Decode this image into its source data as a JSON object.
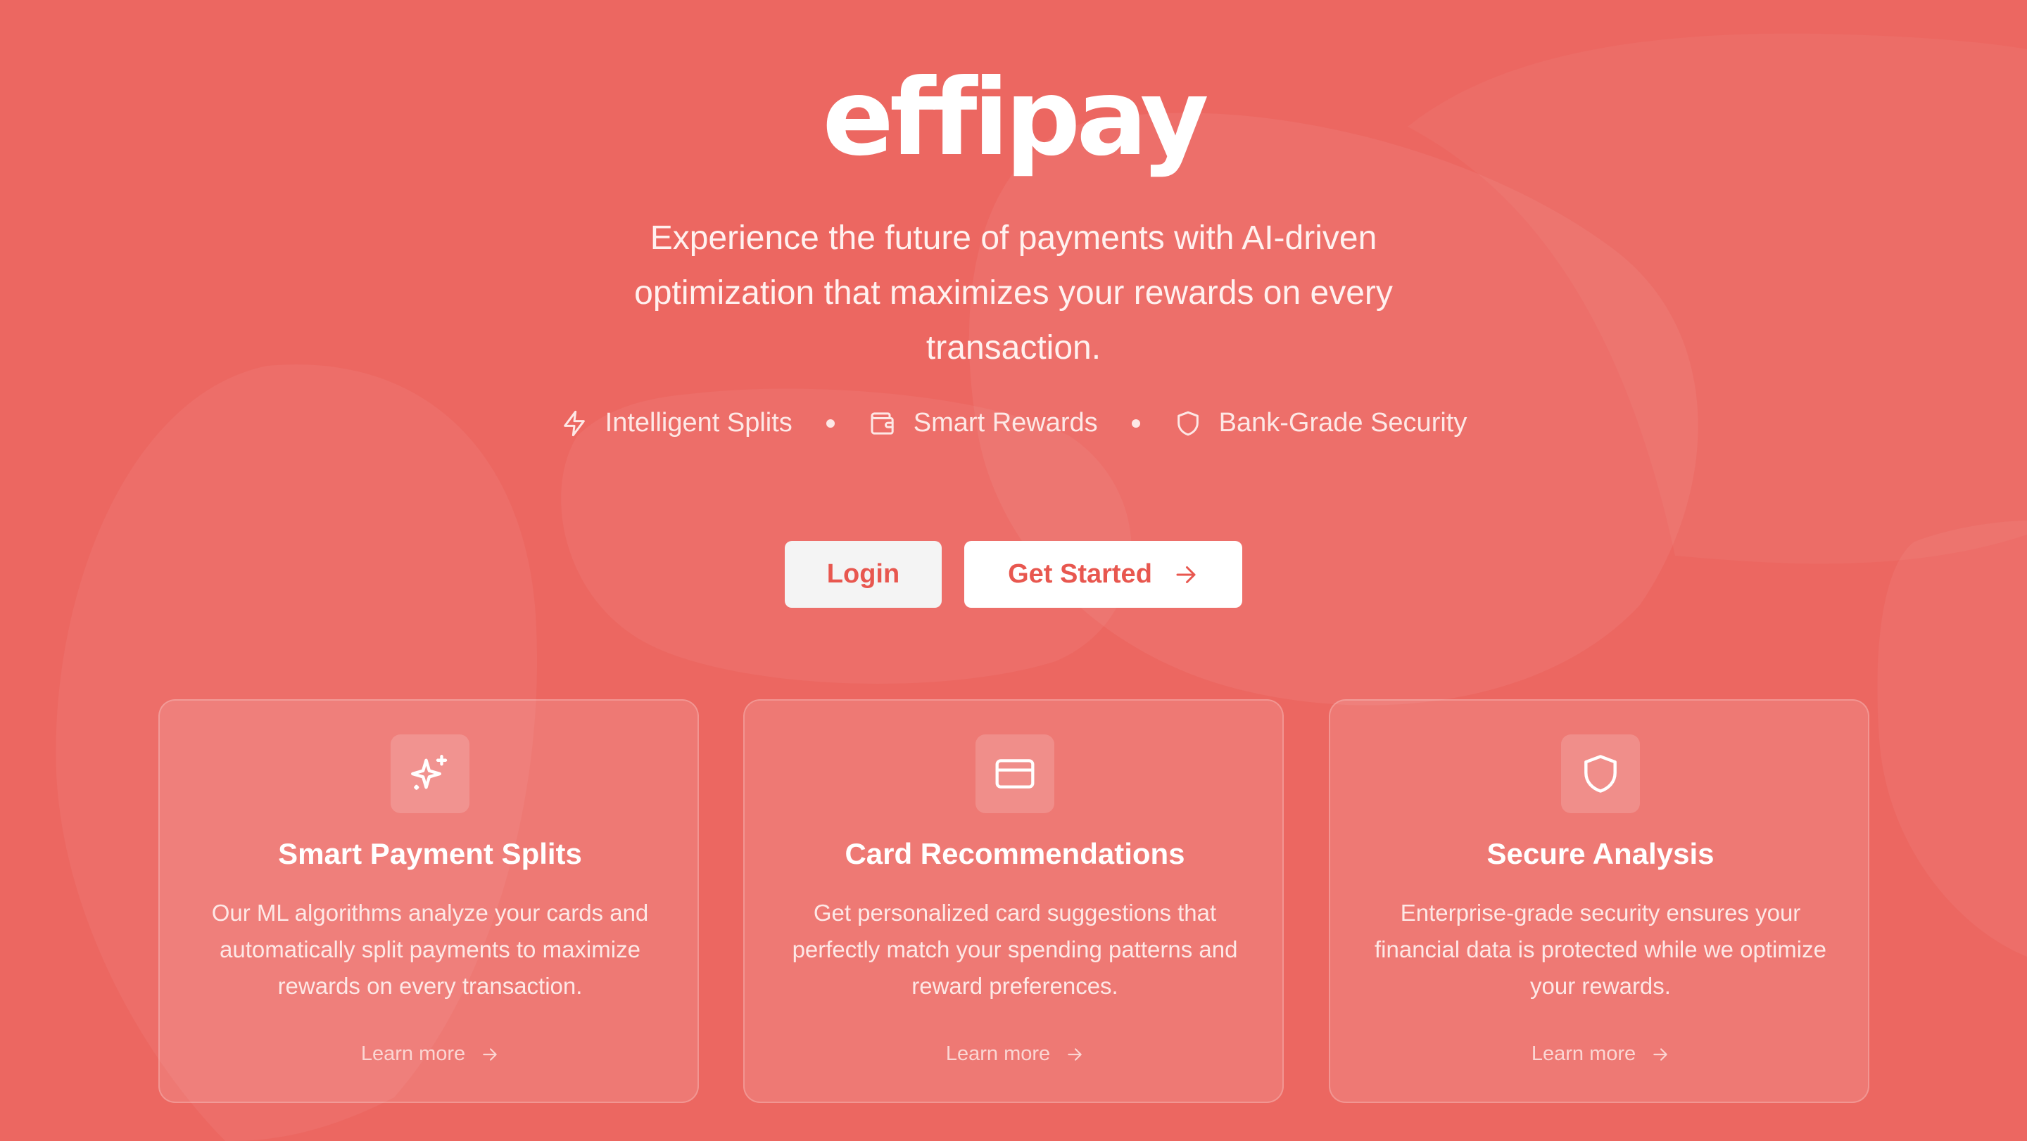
{
  "colors": {
    "background": "#ec6761",
    "button_text": "#e8574f",
    "white": "#ffffff"
  },
  "brand": {
    "logo_text": "effipay"
  },
  "hero": {
    "tagline": "Experience the future of payments with AI-driven optimization that maximizes your rewards on every transaction."
  },
  "features": [
    {
      "icon": "lightning-icon",
      "label": "Intelligent Splits"
    },
    {
      "icon": "wallet-icon",
      "label": "Smart Rewards"
    },
    {
      "icon": "shield-icon",
      "label": "Bank-Grade Security"
    }
  ],
  "actions": {
    "login_label": "Login",
    "get_started_label": "Get Started"
  },
  "cards": [
    {
      "icon": "sparkles-icon",
      "title": "Smart Payment Splits",
      "description": "Our ML algorithms analyze your cards and automatically split payments to maximize rewards on every transaction.",
      "link_label": "Learn more"
    },
    {
      "icon": "credit-card-icon",
      "title": "Card Recommendations",
      "description": "Get personalized card suggestions that perfectly match your spending patterns and reward preferences.",
      "link_label": "Learn more"
    },
    {
      "icon": "shield-icon",
      "title": "Secure Analysis",
      "description": "Enterprise-grade security ensures your financial data is protected while we optimize your rewards.",
      "link_label": "Learn more"
    }
  ]
}
